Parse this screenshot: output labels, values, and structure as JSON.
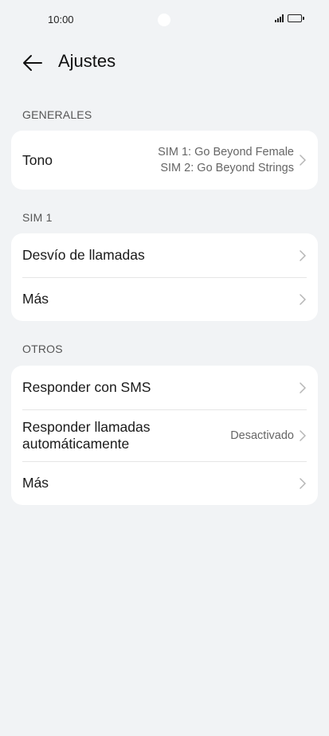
{
  "status": {
    "time": "10:00"
  },
  "header": {
    "title": "Ajustes"
  },
  "sections": {
    "general": {
      "label": "GENERALES",
      "tono": {
        "label": "Tono",
        "value_line1": "SIM 1: Go Beyond Female",
        "value_line2": "SIM 2: Go Beyond Strings"
      }
    },
    "sim1": {
      "label": "SIM 1",
      "desvio": {
        "label": "Desvío de llamadas"
      },
      "mas": {
        "label": "Más"
      }
    },
    "otros": {
      "label": "OTROS",
      "sms": {
        "label": "Responder con SMS"
      },
      "auto": {
        "label_line1": "Responder llamadas",
        "label_line2": "automáticamente",
        "value": "Desactivado"
      },
      "mas": {
        "label": "Más"
      }
    }
  },
  "colors": {
    "background": "#f1f3f5",
    "card": "#ffffff",
    "text": "#1a1a1a",
    "secondary": "#666666"
  }
}
